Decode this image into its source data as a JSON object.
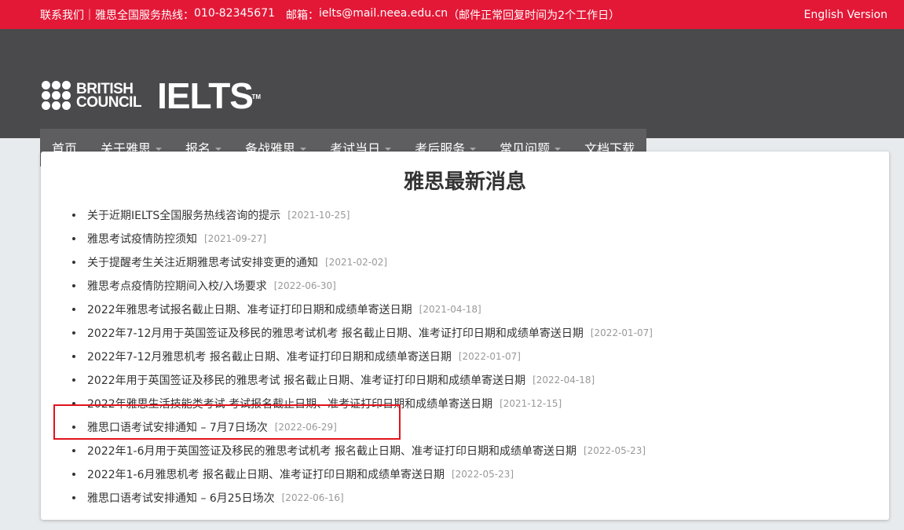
{
  "topbar": {
    "contact_label": "联系我们",
    "separator": "｜",
    "hotline_label": "雅思全国服务热线：",
    "hotline": "010-82345671",
    "email_label": "邮箱：",
    "email": "ielts@mail.neea.edu.cn",
    "email_note": "（邮件正常回复时间为2个工作日）",
    "english_version": "English Version"
  },
  "header": {
    "bc_line1": "BRITISH",
    "bc_line2": "COUNCIL",
    "ielts": "IELTS",
    "tm": "TM"
  },
  "nav": {
    "items": [
      {
        "label": "首页",
        "dropdown": false
      },
      {
        "label": "关于雅思",
        "dropdown": true
      },
      {
        "label": "报名",
        "dropdown": true
      },
      {
        "label": "备战雅思",
        "dropdown": true
      },
      {
        "label": "考试当日",
        "dropdown": true
      },
      {
        "label": "考后服务",
        "dropdown": true
      },
      {
        "label": "常见问题",
        "dropdown": true
      },
      {
        "label": "文档下载",
        "dropdown": false
      }
    ]
  },
  "main": {
    "title": "雅思最新消息",
    "news": [
      {
        "title": "关于近期IELTS全国服务热线咨询的提示",
        "date": "[2021-10-25]"
      },
      {
        "title": "雅思考试疫情防控须知",
        "date": "[2021-09-27]"
      },
      {
        "title": "关于提醒考生关注近期雅思考试安排变更的通知",
        "date": "[2021-02-02]"
      },
      {
        "title": "雅思考点疫情防控期间入校/入场要求",
        "date": "[2022-06-30]"
      },
      {
        "title": "2022年雅思考试报名截止日期、准考证打印日期和成绩单寄送日期",
        "date": "[2021-04-18]"
      },
      {
        "title": "2022年7-12月用于英国签证及移民的雅思考试机考 报名截止日期、准考证打印日期和成绩单寄送日期",
        "date": "[2022-01-07]"
      },
      {
        "title": "2022年7-12月雅思机考 报名截止日期、准考证打印日期和成绩单寄送日期",
        "date": "[2022-01-07]"
      },
      {
        "title": "2022年用于英国签证及移民的雅思考试 报名截止日期、准考证打印日期和成绩单寄送日期",
        "date": "[2022-04-18]"
      },
      {
        "title": "2022年雅思生活技能类考试 考试报名截止日期、准考证打印日期和成绩单寄送日期",
        "date": "[2021-12-15]"
      },
      {
        "title": "雅思口语考试安排通知 – 7月7日场次",
        "date": "[2022-06-29]"
      },
      {
        "title": "2022年1-6月用于英国签证及移民的雅思考试机考 报名截止日期、准考证打印日期和成绩单寄送日期",
        "date": "[2022-05-23]"
      },
      {
        "title": "2022年1-6月雅思机考 报名截止日期、准考证打印日期和成绩单寄送日期",
        "date": "[2022-05-23]"
      },
      {
        "title": "雅思口语考试安排通知 – 6月25日场次",
        "date": "[2022-06-16]"
      }
    ]
  },
  "colors": {
    "topbar": "#e31837",
    "header": "#4a4a4c",
    "nav": "#5e5e60",
    "highlight": "#e0131c"
  }
}
